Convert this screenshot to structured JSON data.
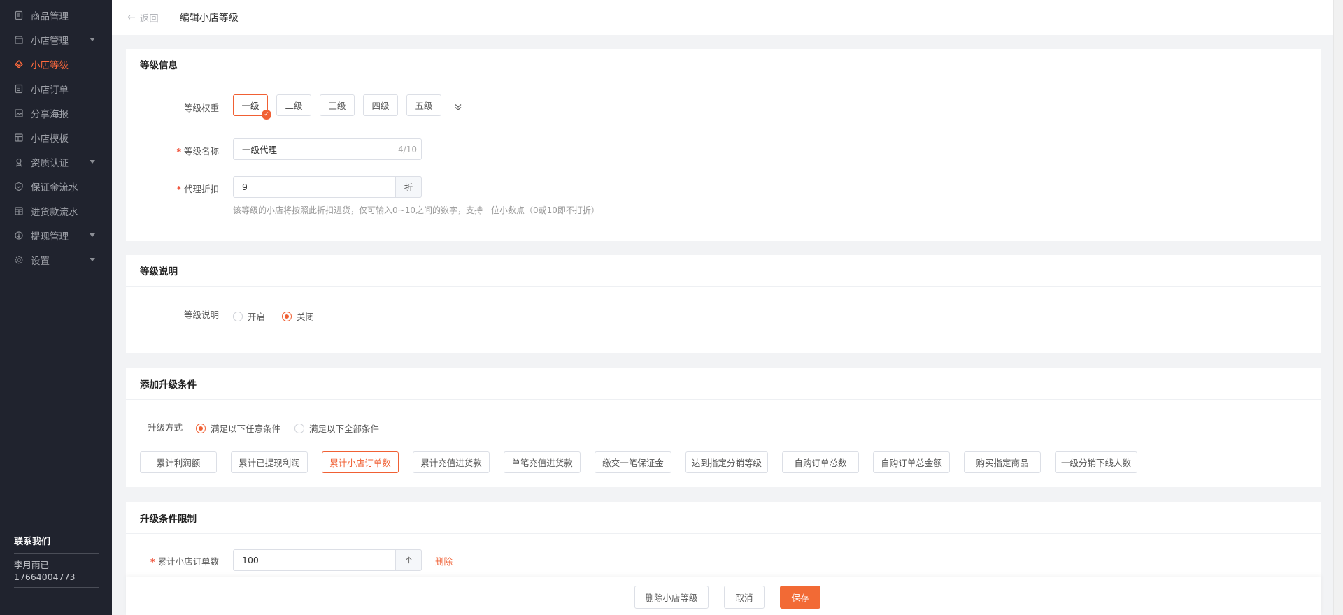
{
  "sidebar": {
    "items": [
      {
        "label": "商品管理",
        "icon": "product-icon",
        "active": false,
        "has_caret": false
      },
      {
        "label": "小店管理",
        "icon": "shop-icon",
        "active": false,
        "has_caret": true
      },
      {
        "label": "小店等级",
        "icon": "level-icon",
        "active": true,
        "has_caret": false
      },
      {
        "label": "小店订单",
        "icon": "order-icon",
        "active": false,
        "has_caret": false
      },
      {
        "label": "分享海报",
        "icon": "poster-icon",
        "active": false,
        "has_caret": false
      },
      {
        "label": "小店模板",
        "icon": "template-icon",
        "active": false,
        "has_caret": false
      },
      {
        "label": "资质认证",
        "icon": "certification-icon",
        "active": false,
        "has_caret": true
      },
      {
        "label": "保证金流水",
        "icon": "shield-icon",
        "active": false,
        "has_caret": false
      },
      {
        "label": "进货款流水",
        "icon": "ledger-icon",
        "active": false,
        "has_caret": false
      },
      {
        "label": "提现管理",
        "icon": "withdraw-icon",
        "active": false,
        "has_caret": true
      },
      {
        "label": "设置",
        "icon": "gear-icon",
        "active": false,
        "has_caret": true
      }
    ],
    "contact": {
      "title": "联系我们",
      "name": "李月雨已",
      "phone": "17664004773"
    }
  },
  "header": {
    "back_label": "返回",
    "title": "编辑小店等级"
  },
  "level_info": {
    "section_title": "等级信息",
    "weight_label": "等级权重",
    "levels": [
      "一级",
      "二级",
      "三级",
      "四级",
      "五级"
    ],
    "selected_level": "一级",
    "name_label": "等级名称",
    "name_value": "一级代理",
    "name_count": "4/10",
    "discount_label": "代理折扣",
    "discount_value": "9",
    "discount_unit": "折",
    "discount_hint": "该等级的小店将按照此折扣进货，仅可输入0~10之间的数字，支持一位小数点（0或10即不打折）"
  },
  "level_desc": {
    "section_title": "等级说明",
    "label": "等级说明",
    "options": [
      "开启",
      "关闭"
    ],
    "selected": "关闭"
  },
  "upgrade": {
    "section_title": "添加升级条件",
    "method_label": "升级方式",
    "methods": [
      "满足以下任意条件",
      "满足以下全部条件"
    ],
    "selected_method": "满足以下任意条件",
    "conditions": [
      "累计利润额",
      "累计已提现利润",
      "累计小店订单数",
      "累计充值进货款",
      "单笔充值进货款",
      "缴交一笔保证金",
      "达到指定分销等级",
      "自购订单总数",
      "自购订单总金额",
      "购买指定商品",
      "一级分销下线人数"
    ],
    "selected_condition": "累计小店订单数"
  },
  "limits": {
    "section_title": "升级条件限制",
    "rows": [
      {
        "label": "累计小店订单数",
        "value": "100",
        "delete_label": "删除"
      }
    ]
  },
  "footer": {
    "delete_label": "删除小店等级",
    "cancel_label": "取消",
    "save_label": "保存"
  },
  "colors": {
    "accent": "#f06034",
    "sidebar_bg": "#20232e"
  }
}
